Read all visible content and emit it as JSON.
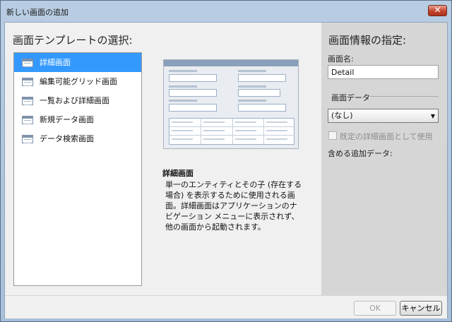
{
  "window": {
    "title": "新しい画面の追加",
    "close_label": "✕"
  },
  "left": {
    "title": "画面テンプレートの選択:",
    "templates": [
      {
        "label": "詳細画面",
        "icon": "detail-screen-icon",
        "selected": true
      },
      {
        "label": "編集可能グリッド画面",
        "icon": "editable-grid-icon",
        "selected": false
      },
      {
        "label": "一覧および詳細画面",
        "icon": "list-detail-icon",
        "selected": false
      },
      {
        "label": "新規データ画面",
        "icon": "new-data-icon",
        "selected": false
      },
      {
        "label": "データ検索画面",
        "icon": "search-data-icon",
        "selected": false
      }
    ],
    "description_title": "詳細画面",
    "description": "単一のエンティティとその子 (存在する場合) を表示するために使用される画面。詳細画面はアプリケーションのナビゲーション メニューに表示されず、他の画面から起動されます。"
  },
  "right": {
    "title": "画面情報の指定:",
    "name_label": "画面名:",
    "name_value": "Detail",
    "data_label": "画面データ",
    "data_selected": "(なし)",
    "default_check_label": "既定の詳細画面として使用",
    "default_checked": false,
    "extra_label": "含める追加データ:"
  },
  "footer": {
    "ok_label": "OK",
    "cancel_label": "キャンセル"
  },
  "colors": {
    "selection": "#3399ff",
    "right_pane": "#d6d6d6",
    "titlebar": "#b8cde3",
    "close": "#c4432c"
  }
}
